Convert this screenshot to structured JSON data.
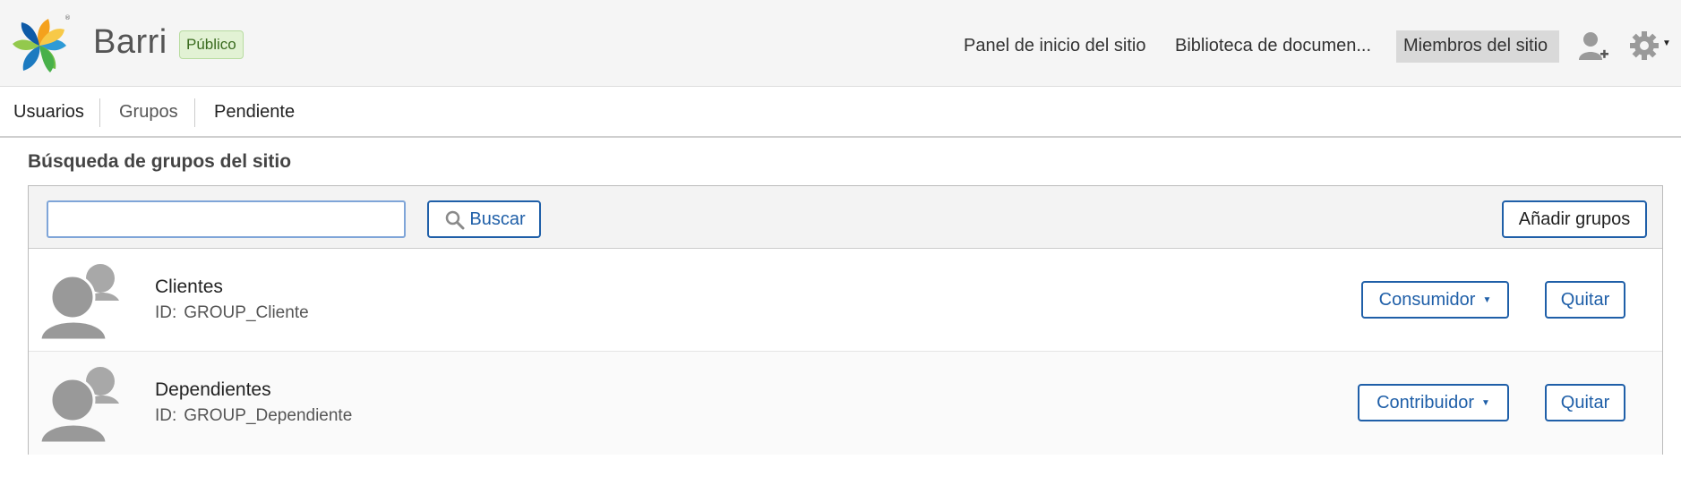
{
  "header": {
    "site_name": "Barri",
    "visibility": "Público",
    "nav": [
      {
        "label": "Panel de inicio del sitio",
        "active": false
      },
      {
        "label": "Biblioteca de documen...",
        "active": false
      },
      {
        "label": "Miembros del sitio",
        "active": true
      }
    ],
    "icons": [
      "invite-user-icon",
      "gear-icon"
    ]
  },
  "tabs": [
    {
      "label": "Usuarios"
    },
    {
      "label": "Grupos"
    },
    {
      "label": "Pendiente"
    }
  ],
  "section_title": "Búsqueda de grupos del sitio",
  "search": {
    "value": "",
    "placeholder": "",
    "button_label": "Buscar"
  },
  "add_groups_label": "Añadir grupos",
  "groups": [
    {
      "name": "Clientes",
      "id_label": "ID:",
      "id": "GROUP_Cliente",
      "role": "Consumidor",
      "remove_label": "Quitar"
    },
    {
      "name": "Dependientes",
      "id_label": "ID:",
      "id": "GROUP_Dependiente",
      "role": "Contribuidor",
      "remove_label": "Quitar"
    }
  ],
  "colors": {
    "accent": "#1f5fa8",
    "header_bg": "#f5f5f5",
    "badge_bg": "#e2f2d4",
    "active_nav_bg": "#d9d9d9"
  }
}
